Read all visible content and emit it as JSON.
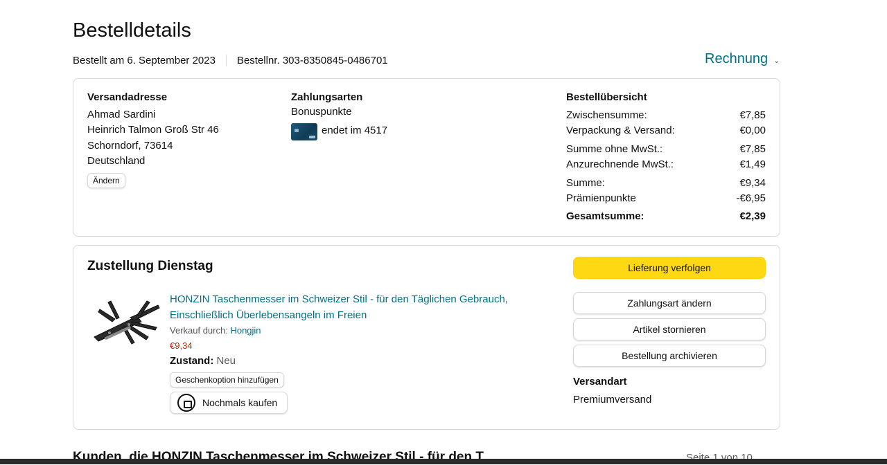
{
  "page": {
    "title": "Bestelldetails"
  },
  "order": {
    "date_text": "Bestellt am 6. September 2023",
    "number_text": "Bestellnr. 303-8350845-0486701",
    "invoice_label": "Rechnung"
  },
  "shipping": {
    "heading": "Versandadresse",
    "name": "Ahmad Sardini",
    "street": "Heinrich Talmon Groß Str 46",
    "city": "Schorndorf, 73614",
    "country": "Deutschland",
    "change_label": "Ändern"
  },
  "payment": {
    "heading": "Zahlungsarten",
    "method1": "Bonuspunkte",
    "card_text": "endet im 4517"
  },
  "summary": {
    "heading": "Bestellübersicht",
    "rows": [
      {
        "label": "Zwischensumme:",
        "value": "€7,85"
      },
      {
        "label": "Verpackung & Versand:",
        "value": "€0,00"
      },
      {
        "label": "Summe ohne MwSt.:",
        "value": "€7,85"
      },
      {
        "label": "Anzurechnende MwSt.:",
        "value": "€1,49"
      },
      {
        "label": "Summe:",
        "value": "€9,34"
      },
      {
        "label": "Prämienpunkte",
        "value": "-€6,95"
      },
      {
        "label": "Gesamtsumme:",
        "value": "€2,39"
      }
    ]
  },
  "delivery": {
    "heading": "Zustellung Dienstag",
    "product": {
      "title": "HONZIN Taschenmesser im Schweizer Stil - für den Täglichen Gebrauch, Einschließlich Überlebensangeln im Freien",
      "seller_prefix": "Verkauf durch:",
      "seller_name": "Hongjin",
      "price": "€9,34",
      "condition_label": "Zustand:",
      "condition_value": "Neu",
      "gift_label": "Geschenkoption hinzufügen",
      "rebuy_label": "Nochmals kaufen"
    },
    "actions": {
      "track": "Lieferung verfolgen",
      "change_payment": "Zahlungsart ändern",
      "cancel": "Artikel stornieren",
      "archive": "Bestellung archivieren"
    },
    "shipping_type_heading": "Versandart",
    "shipping_type_value": "Premiumversand"
  },
  "recommendations": {
    "heading": "Kunden, die HONZIN Taschenmesser im Schweizer Stil - für den T",
    "pager": "Seite 1 von 10"
  },
  "colors": {
    "link": "#007185",
    "primary_button": "#ffd814",
    "price": "#b12704"
  }
}
